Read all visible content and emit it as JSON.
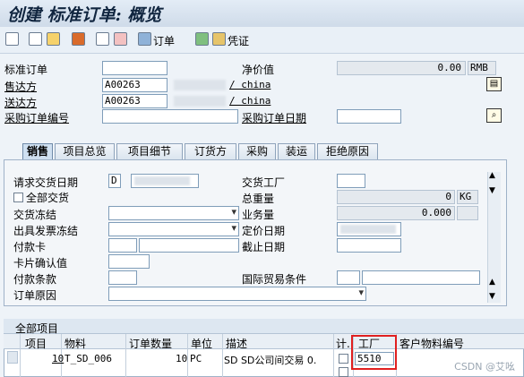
{
  "window": {
    "title": "创建 标准订单: 概览"
  },
  "toolbar": {
    "orders_label": "订单",
    "vouchers_label": "凭证"
  },
  "header": {
    "order_type_label": "标准订单",
    "sold_to_label": "售达方",
    "sold_to_value": "A00263",
    "sold_to_country": "/ china",
    "ship_to_label": "送达方",
    "ship_to_value": "A00263",
    "ship_to_country": "/ china",
    "po_number_label": "采购订单编号",
    "net_value_label": "净价值",
    "net_value": "0.00",
    "currency": "RMB",
    "po_date_label": "采购订单日期"
  },
  "tabs": [
    "销售",
    "项目总览",
    "项目细节",
    "订货方",
    "采购",
    "装运",
    "拒绝原因"
  ],
  "sales": {
    "req_delivery_date_label": "请求交货日期",
    "req_delivery_date_format": "D",
    "complete_delivery_label": "全部交货",
    "delivery_block_label": "交货冻结",
    "billing_block_label": "出具发票冻结",
    "payment_card_label": "付款卡",
    "card_verify_label": "卡片确认值",
    "payment_terms_label": "付款条款",
    "order_reason_label": "订单原因",
    "delivering_plant_label": "交货工厂",
    "total_weight_label": "总重量",
    "total_weight_value": "0",
    "weight_unit": "KG",
    "volume_label": "业务量",
    "volume_value": "0.000",
    "pricing_date_label": "定价日期",
    "expiry_date_label": "截止日期",
    "incoterms_label": "国际贸易条件"
  },
  "items": {
    "title": "全部项目",
    "columns": [
      "项目",
      "物料",
      "订单数量",
      "单位",
      "描述",
      "计.",
      "工厂",
      "客户物料编号"
    ],
    "rows": [
      {
        "item": "10",
        "material": "T_SD_006",
        "quantity": "10",
        "unit": "PC",
        "description": "SD SD公司间交易 0.",
        "plant": "5510"
      }
    ]
  },
  "watermark": "CSDN @艾吆"
}
